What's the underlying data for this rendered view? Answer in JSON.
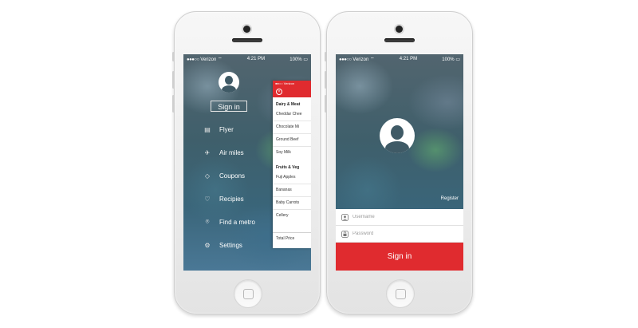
{
  "left_phone": {
    "status": {
      "carrier": "Verizon",
      "time": "4:21 PM",
      "battery": "100%"
    },
    "sign_in_label": "Sign in",
    "menu": [
      {
        "label": "Flyer",
        "icon": "flyer-icon"
      },
      {
        "label": "Air miles",
        "icon": "airplane-icon"
      },
      {
        "label": "Coupons",
        "icon": "tag-icon"
      },
      {
        "label": "Recipies",
        "icon": "heart-icon"
      },
      {
        "label": "Find a metro",
        "icon": "location-pin-icon"
      },
      {
        "label": "Settings",
        "icon": "gear-icon"
      }
    ],
    "list_panel": {
      "status_carrier": "Verizon",
      "sections": [
        {
          "title": "Dairy & Meat",
          "items": [
            "Cheddar Chee",
            "Chocolate Mi",
            "Ground Beef",
            "Soy Milk"
          ]
        },
        {
          "title": "Fruits & Veg",
          "items": [
            "Fuji Apples",
            "Bananas",
            "Baby Carrots",
            "Cellery"
          ]
        }
      ],
      "total_label": "Total Price"
    }
  },
  "right_phone": {
    "status": {
      "carrier": "Verizon",
      "time": "4:21 PM",
      "battery": "100%"
    },
    "register_label": "Register",
    "username_placeholder": "Username",
    "password_placeholder": "Password",
    "sign_in_button": "Sign in"
  },
  "colors": {
    "accent_red": "#e02b2f"
  }
}
